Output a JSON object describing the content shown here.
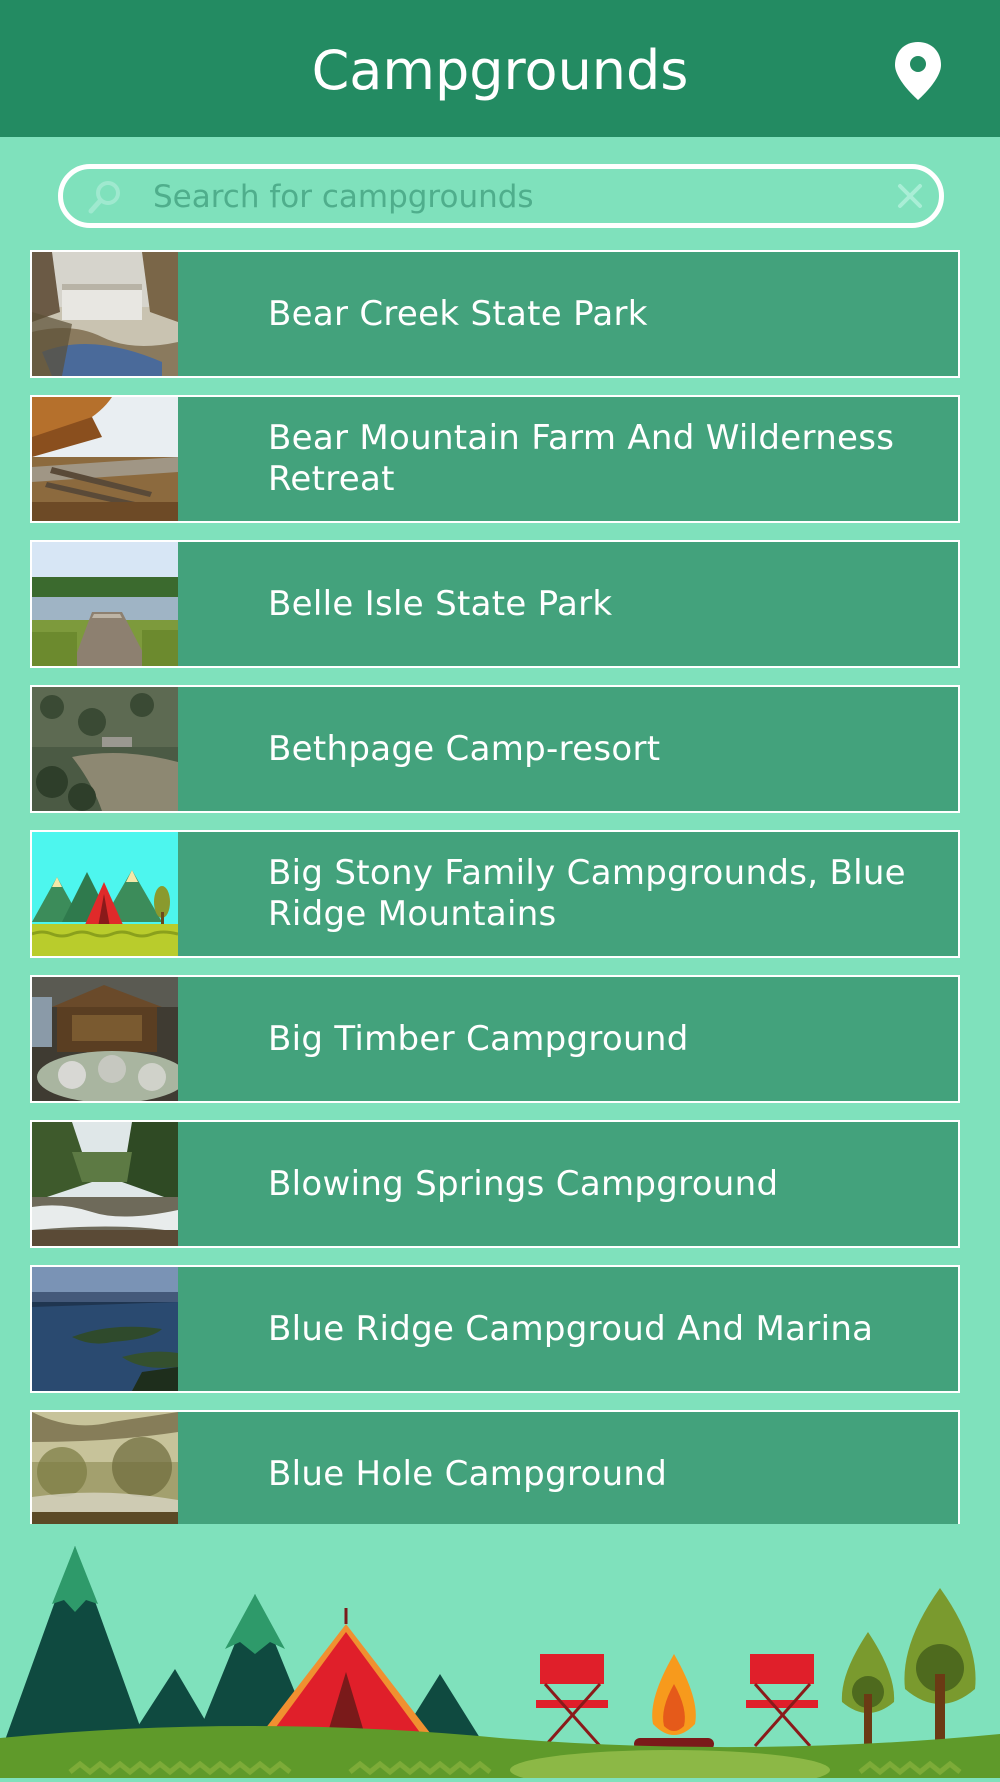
{
  "header": {
    "title": "Campgrounds",
    "location_icon": "map-pin-icon"
  },
  "search": {
    "placeholder": "Search for campgrounds",
    "value": "",
    "search_icon": "magnifier-icon",
    "clear_icon": "close-icon"
  },
  "campgrounds": [
    {
      "name": "Bear Creek State Park",
      "thumbnail": "waterfall-creek-photo"
    },
    {
      "name": "Bear Mountain Farm And Wilderness Retreat",
      "thumbnail": "split-rail-fence-photo"
    },
    {
      "name": "Belle Isle State Park",
      "thumbnail": "dock-lake-photo"
    },
    {
      "name": "Bethpage Camp-resort",
      "thumbnail": "aerial-river-photo"
    },
    {
      "name": "Big Stony Family Campgrounds, Blue Ridge Mountains",
      "thumbnail": "tent-illustration"
    },
    {
      "name": "Big Timber Campground",
      "thumbnail": "entrance-sign-photo"
    },
    {
      "name": "Blowing Springs Campground",
      "thumbnail": "river-rapids-photo"
    },
    {
      "name": "Blue Ridge Campgroud And Marina",
      "thumbnail": "lake-aerial-photo"
    },
    {
      "name": "Blue Hole Campground",
      "thumbnail": "misty-forest-photo"
    }
  ],
  "colors": {
    "header": "#238b62",
    "background": "#7fe1bc",
    "row": "#43a27c",
    "row_border": "#ffffff"
  }
}
